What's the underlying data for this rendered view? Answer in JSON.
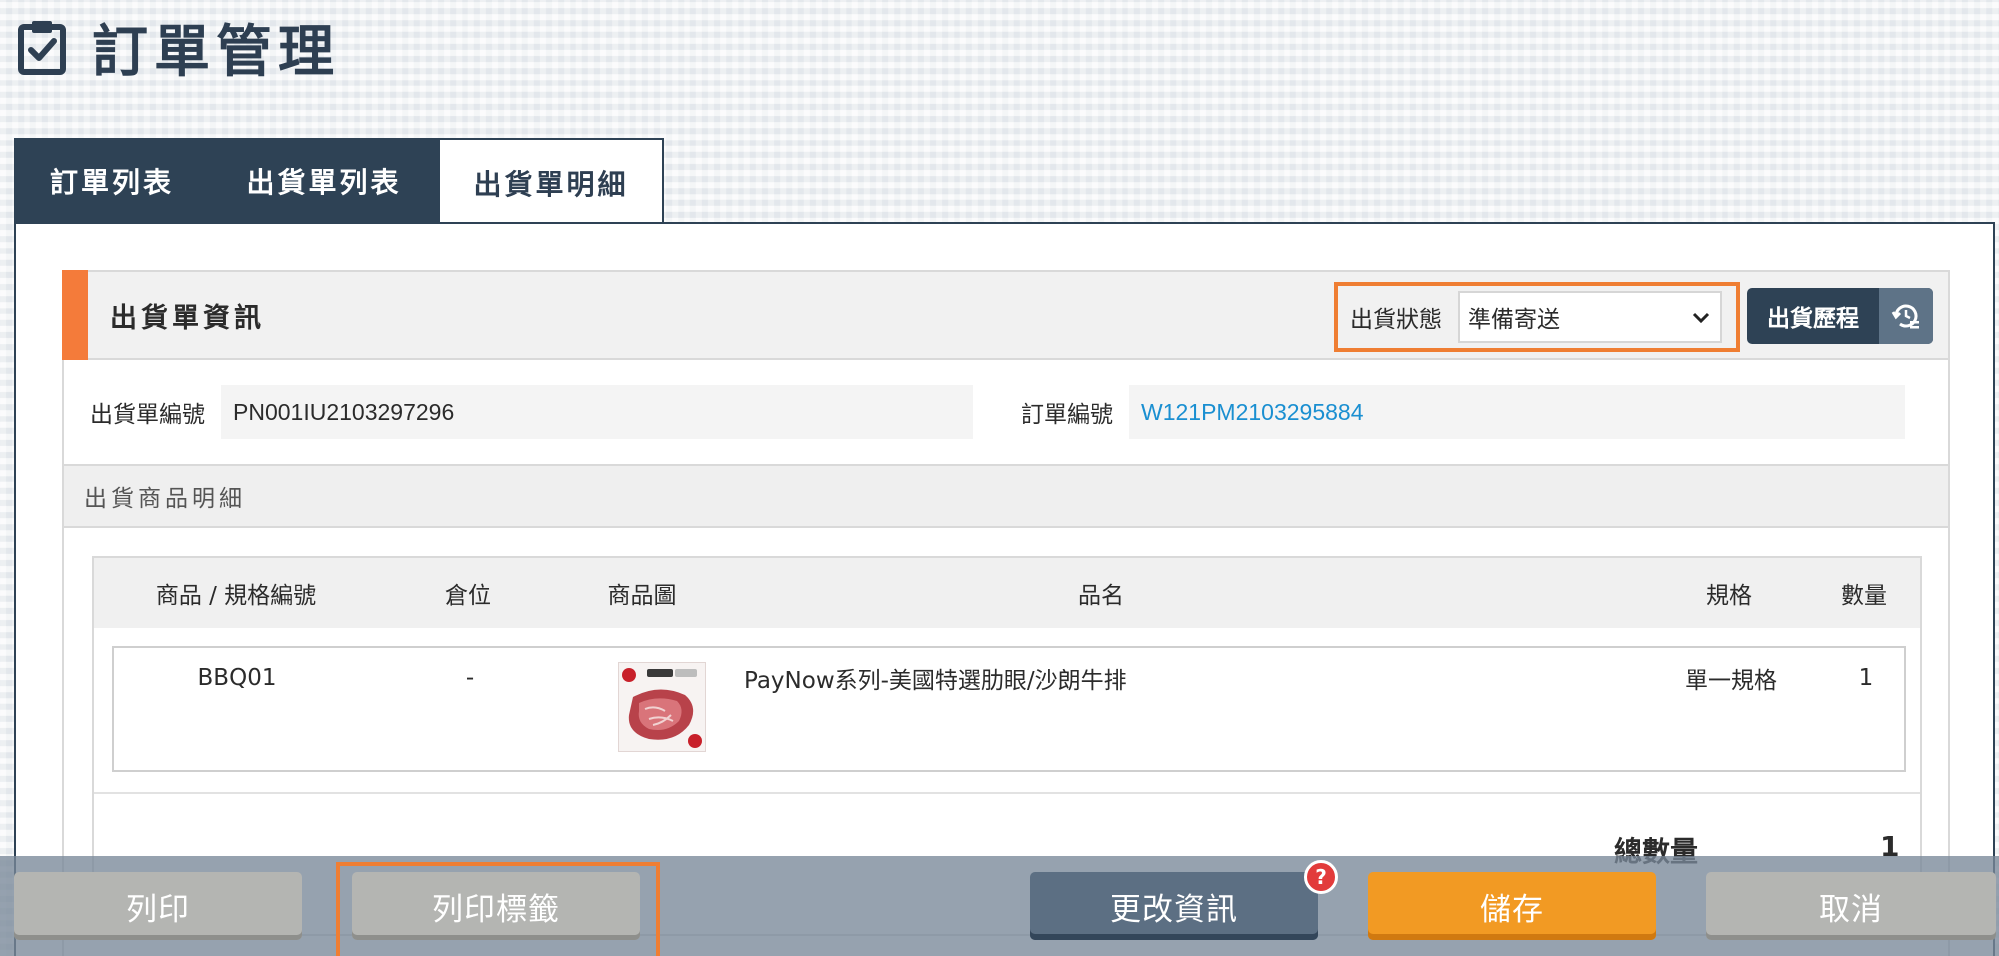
{
  "page": {
    "title": "訂單管理",
    "title_icon": "clipboard-check-icon"
  },
  "tabs": [
    {
      "label": "訂單列表",
      "active": false
    },
    {
      "label": "出貨單列表",
      "active": false
    },
    {
      "label": "出貨單明細",
      "active": true
    }
  ],
  "shipment_info": {
    "heading": "出貨單資訊",
    "status_label": "出貨狀態",
    "status_value": "準備寄送",
    "history_button": "出貨歷程",
    "history_icon": "history-list-icon",
    "shipment_no_label": "出貨單編號",
    "shipment_no": "PN001IU2103297296",
    "order_no_label": "訂單編號",
    "order_no": "W121PM2103295884"
  },
  "items_section": {
    "heading": "出貨商品明細",
    "columns": [
      "商品 / 規格編號",
      "倉位",
      "商品圖",
      "品名",
      "規格",
      "數量"
    ],
    "rows": [
      {
        "code": "BBQ01",
        "location": "-",
        "image": "steak-product-image",
        "name": "PayNow系列-美國特選肋眼/沙朗牛排",
        "spec": "單一規格",
        "qty": "1"
      }
    ],
    "total_label": "總數量",
    "total_value": "1"
  },
  "footer": {
    "print": "列印",
    "print_label": "列印標籤",
    "edit": "更改資訊",
    "help": "?",
    "save": "儲存",
    "cancel": "取消"
  },
  "colors": {
    "navy": "#2e4255",
    "accent_orange": "#f47b3a",
    "highlight_frame": "#ef7e33",
    "save_orange": "#f29a23",
    "link_blue": "#1a8fd1"
  }
}
